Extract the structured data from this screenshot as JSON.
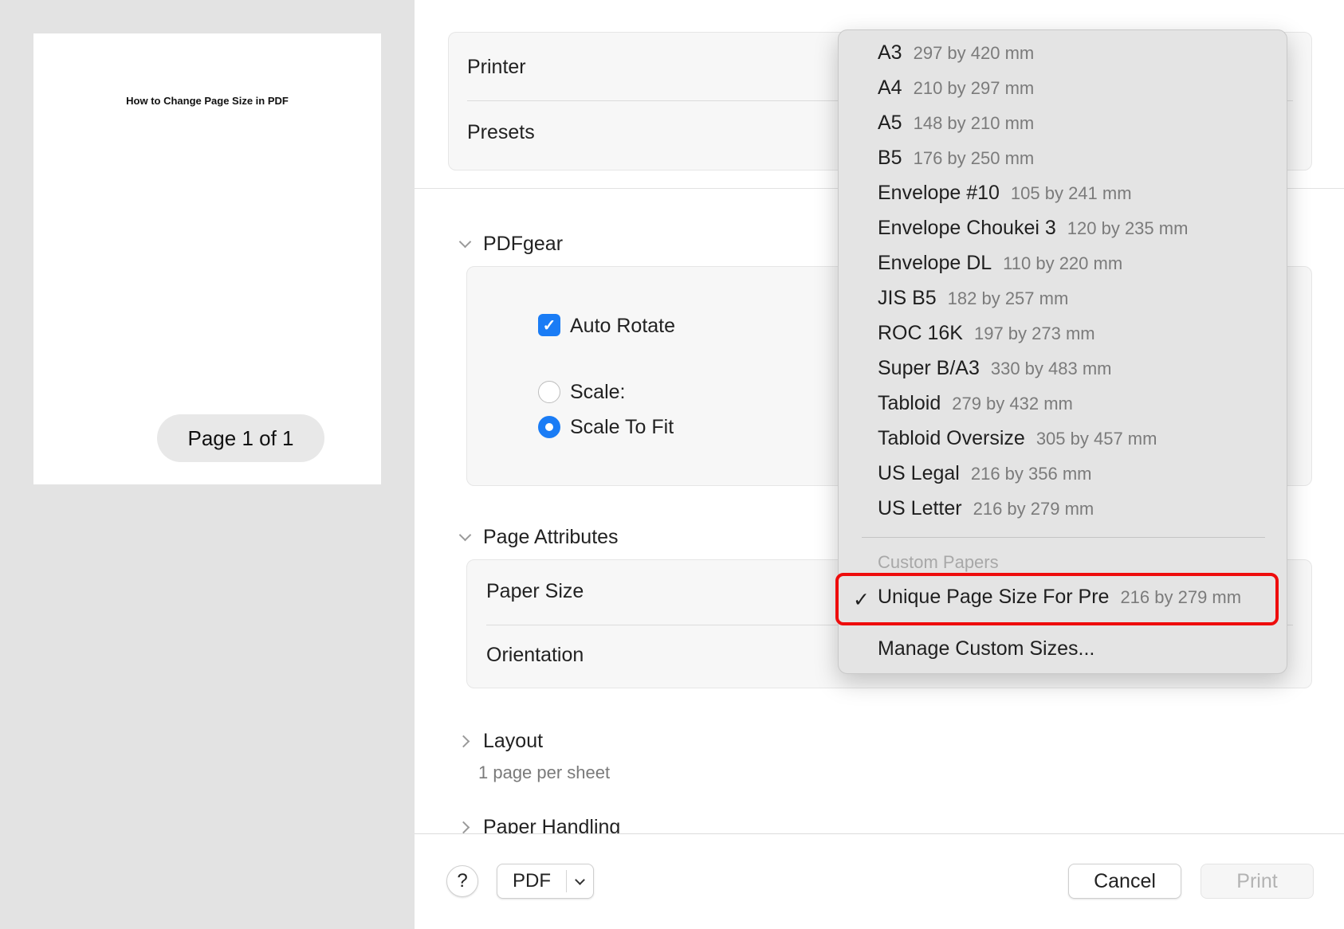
{
  "preview": {
    "document_title": "How to Change Page Size in PDF",
    "page_indicator": "Page 1 of 1"
  },
  "header": {
    "printer_label": "Printer",
    "presets_label": "Presets"
  },
  "pdfgear": {
    "title": "PDFgear",
    "auto_rotate": {
      "label": "Auto Rotate",
      "checked": true
    },
    "scale": {
      "label": "Scale:",
      "selected": false
    },
    "scale_to_fit": {
      "label": "Scale To Fit",
      "selected": true
    }
  },
  "page_attributes": {
    "title": "Page Attributes",
    "paper_size_label": "Paper Size",
    "orientation_label": "Orientation"
  },
  "layout": {
    "title": "Layout",
    "summary": "1 page per sheet"
  },
  "paper_handling": {
    "title": "Paper Handling"
  },
  "bottom": {
    "help_label": "?",
    "pdf_label": "PDF",
    "cancel_label": "Cancel",
    "print_label": "Print"
  },
  "paper_menu": {
    "items": [
      {
        "name": "A3",
        "size": "297 by 420 mm"
      },
      {
        "name": "A4",
        "size": "210 by 297 mm"
      },
      {
        "name": "A5",
        "size": "148 by 210 mm"
      },
      {
        "name": "B5",
        "size": "176 by 250 mm"
      },
      {
        "name": "Envelope #10",
        "size": "105 by 241 mm"
      },
      {
        "name": "Envelope Choukei 3",
        "size": "120 by 235 mm"
      },
      {
        "name": "Envelope DL",
        "size": "110 by 220 mm"
      },
      {
        "name": "JIS B5",
        "size": "182 by 257 mm"
      },
      {
        "name": "ROC 16K",
        "size": "197 by 273 mm"
      },
      {
        "name": "Super B/A3",
        "size": "330 by 483 mm"
      },
      {
        "name": "Tabloid",
        "size": "279 by 432 mm"
      },
      {
        "name": "Tabloid Oversize",
        "size": "305 by 457 mm"
      },
      {
        "name": "US Legal",
        "size": "216 by 356 mm"
      },
      {
        "name": "US Letter",
        "size": "216 by 279 mm"
      }
    ],
    "custom_header": "Custom Papers",
    "custom_item": {
      "check": "✓",
      "name": "Unique Page Size For Pre",
      "size": "216 by 279 mm",
      "selected": true
    },
    "manage_label": "Manage Custom Sizes...",
    "highlight_color": "#ee0c0c"
  },
  "colors": {
    "accent": "#1a7cf5",
    "preview_background": "#e3e3e3"
  }
}
